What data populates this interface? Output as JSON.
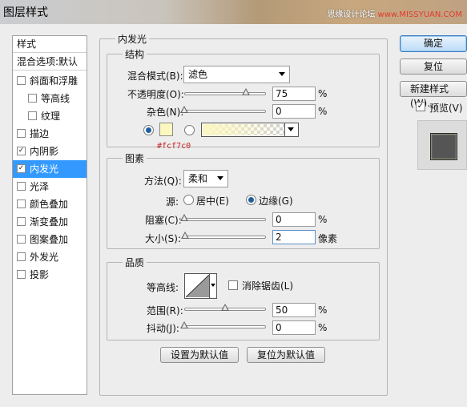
{
  "window": {
    "title": "图层样式",
    "watermark": "思缘设计论坛",
    "watermark_url": "www.MISSYUAN.COM"
  },
  "styles_list": {
    "header": "样式",
    "blend_options": "混合选项:默认",
    "items": [
      {
        "label": "斜面和浮雕",
        "checked": false
      },
      {
        "label": "等高线",
        "checked": false,
        "indent": true
      },
      {
        "label": "纹理",
        "checked": false,
        "indent": true
      },
      {
        "label": "描边",
        "checked": false
      },
      {
        "label": "内阴影",
        "checked": true
      },
      {
        "label": "内发光",
        "checked": true,
        "selected": true
      },
      {
        "label": "光泽",
        "checked": false
      },
      {
        "label": "颜色叠加",
        "checked": false
      },
      {
        "label": "渐变叠加",
        "checked": false
      },
      {
        "label": "图案叠加",
        "checked": false
      },
      {
        "label": "外发光",
        "checked": false
      },
      {
        "label": "投影",
        "checked": false
      }
    ],
    "check_mark": "✓"
  },
  "inner_glow": {
    "title": "内发光",
    "structure": {
      "title": "结构",
      "blend_mode_label": "混合模式(B):",
      "blend_mode_value": "滤色",
      "opacity_label": "不透明度(O):",
      "opacity_value": "75",
      "opacity_unit": "%",
      "opacity_fraction": 0.75,
      "noise_label": "杂色(N):",
      "noise_value": "0",
      "noise_unit": "%",
      "noise_fraction": 0,
      "glow_color_hex": "#fcf7c0",
      "glow_color_label": "#fcf7c0"
    },
    "elements": {
      "title": "图素",
      "technique_label": "方法(Q):",
      "technique_value": "柔和",
      "source_label": "源:",
      "source_center": "居中(E)",
      "source_edge": "边缘(G)",
      "choke_label": "阻塞(C):",
      "choke_value": "0",
      "choke_unit": "%",
      "choke_fraction": 0,
      "size_label": "大小(S):",
      "size_value": "2",
      "size_unit": "像素",
      "size_fraction": 0.01
    },
    "quality": {
      "title": "品质",
      "contour_label": "等高线:",
      "anti_alias_label": "消除锯齿(L)",
      "range_label": "范围(R):",
      "range_value": "50",
      "range_unit": "%",
      "range_fraction": 0.5,
      "jitter_label": "抖动(J):",
      "jitter_value": "0",
      "jitter_unit": "%",
      "jitter_fraction": 0
    },
    "make_default": "设置为默认值",
    "reset_default": "复位为默认值"
  },
  "right_buttons": {
    "ok": "确定",
    "reset": "复位",
    "new_style": "新建样式(W)...",
    "preview_label": "预览(V)"
  }
}
